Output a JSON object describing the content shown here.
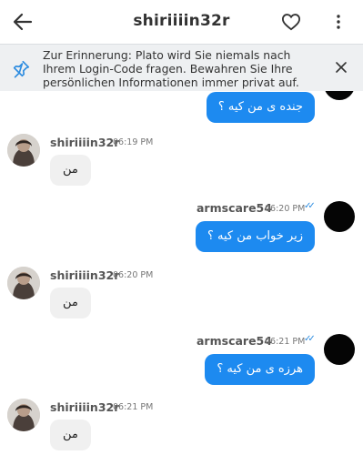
{
  "header": {
    "title": "shiriiiin32r",
    "back_icon": "arrow-left-icon",
    "favorite_icon": "heart-outline-icon",
    "menu_icon": "more-vertical-icon"
  },
  "banner": {
    "text": "Zur Erinnerung: Plato wird Sie niemals nach Ihrem Login-Code fragen. Bewahren Sie Ihre persönlichen Informationen immer privat auf.",
    "icon": "pin-icon",
    "close_icon": "close-icon"
  },
  "messages": [
    {
      "direction": "outgoing",
      "text": "جنده ی من کیه ؟"
    },
    {
      "direction": "incoming",
      "sender": "shiriiiin32r",
      "time": "06:19 PM",
      "text": "من"
    },
    {
      "direction": "outgoing",
      "sender": "armscare54",
      "time": "06:20 PM",
      "text": "زیر خواب من کیه ؟",
      "status_icon": "double-check-icon"
    },
    {
      "direction": "incoming",
      "sender": "shiriiiin32r",
      "time": "06:20 PM",
      "text": "من"
    },
    {
      "direction": "outgoing",
      "sender": "armscare54",
      "time": "06:21 PM",
      "text": "هرزه ی من کیه ؟",
      "status_icon": "double-check-icon"
    },
    {
      "direction": "incoming",
      "sender": "shiriiiin32r",
      "time": "06:21 PM",
      "text": "من"
    }
  ],
  "colors": {
    "outgoing_bubble": "#1d8af0",
    "incoming_bubble": "#f0f0f0",
    "banner_bg": "#eef0f2",
    "accent": "#2d8ce0"
  }
}
